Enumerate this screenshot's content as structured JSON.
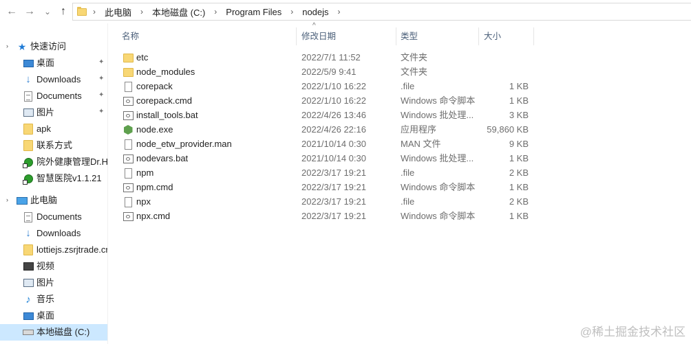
{
  "nav_buttons": {
    "back": "←",
    "forward": "→",
    "recent": "⌄",
    "up": "↑"
  },
  "breadcrumb": [
    "此电脑",
    "本地磁盘 (C:)",
    "Program Files",
    "nodejs"
  ],
  "breadcrumb_sep": "›",
  "sidebar": {
    "quick_access": {
      "label": "快速访问",
      "icon": "star-icon"
    },
    "quick_items": [
      {
        "label": "桌面",
        "icon": "desktop-icon",
        "pinned": true
      },
      {
        "label": "Downloads",
        "icon": "download-icon",
        "pinned": true
      },
      {
        "label": "Documents",
        "icon": "document-icon",
        "pinned": true
      },
      {
        "label": "图片",
        "icon": "pictures-icon",
        "pinned": true
      },
      {
        "label": "apk",
        "icon": "folder-icon",
        "pinned": false
      },
      {
        "label": "联系方式",
        "icon": "folder-icon",
        "pinned": false
      },
      {
        "label": "院外健康管理Dr.Hi",
        "icon": "shortcut-icon",
        "pinned": false
      },
      {
        "label": "智慧医院v1.1.21",
        "icon": "shortcut-icon",
        "pinned": false
      }
    ],
    "this_pc": {
      "label": "此电脑",
      "icon": "computer-icon"
    },
    "pc_items": [
      {
        "label": "Documents",
        "icon": "document-icon"
      },
      {
        "label": "Downloads",
        "icon": "download-icon"
      },
      {
        "label": "lottiejs.zsrjtrade.cn",
        "icon": "folder-icon"
      },
      {
        "label": "视频",
        "icon": "video-icon"
      },
      {
        "label": "图片",
        "icon": "pictures-icon"
      },
      {
        "label": "音乐",
        "icon": "music-icon"
      },
      {
        "label": "桌面",
        "icon": "desktop-icon"
      },
      {
        "label": "本地磁盘 (C:)",
        "icon": "drive-icon",
        "selected": true
      }
    ],
    "pin_glyph": "📌"
  },
  "columns": {
    "name": "名称",
    "date": "修改日期",
    "type": "类型",
    "size": "大小"
  },
  "files": [
    {
      "name": "etc",
      "date": "2022/7/1 11:52",
      "type": "文件夹",
      "size": "",
      "icon": "folder-icon"
    },
    {
      "name": "node_modules",
      "date": "2022/5/9 9:41",
      "type": "文件夹",
      "size": "",
      "icon": "folder-icon"
    },
    {
      "name": "corepack",
      "date": "2022/1/10 16:22",
      "type": ".file",
      "size": "1 KB",
      "icon": "file-icon"
    },
    {
      "name": "corepack.cmd",
      "date": "2022/1/10 16:22",
      "type": "Windows 命令脚本",
      "size": "1 KB",
      "icon": "cmd-icon"
    },
    {
      "name": "install_tools.bat",
      "date": "2022/4/26 13:46",
      "type": "Windows 批处理...",
      "size": "3 KB",
      "icon": "cmd-icon"
    },
    {
      "name": "node.exe",
      "date": "2022/4/26 22:16",
      "type": "应用程序",
      "size": "59,860 KB",
      "icon": "node-exe-icon"
    },
    {
      "name": "node_etw_provider.man",
      "date": "2021/10/14 0:30",
      "type": "MAN 文件",
      "size": "9 KB",
      "icon": "file-icon"
    },
    {
      "name": "nodevars.bat",
      "date": "2021/10/14 0:30",
      "type": "Windows 批处理...",
      "size": "1 KB",
      "icon": "cmd-icon"
    },
    {
      "name": "npm",
      "date": "2022/3/17 19:21",
      "type": ".file",
      "size": "2 KB",
      "icon": "file-icon"
    },
    {
      "name": "npm.cmd",
      "date": "2022/3/17 19:21",
      "type": "Windows 命令脚本",
      "size": "1 KB",
      "icon": "cmd-icon"
    },
    {
      "name": "npx",
      "date": "2022/3/17 19:21",
      "type": ".file",
      "size": "2 KB",
      "icon": "file-icon"
    },
    {
      "name": "npx.cmd",
      "date": "2022/3/17 19:21",
      "type": "Windows 命令脚本",
      "size": "1 KB",
      "icon": "cmd-icon"
    }
  ],
  "watermark": "@稀土掘金技术社区"
}
